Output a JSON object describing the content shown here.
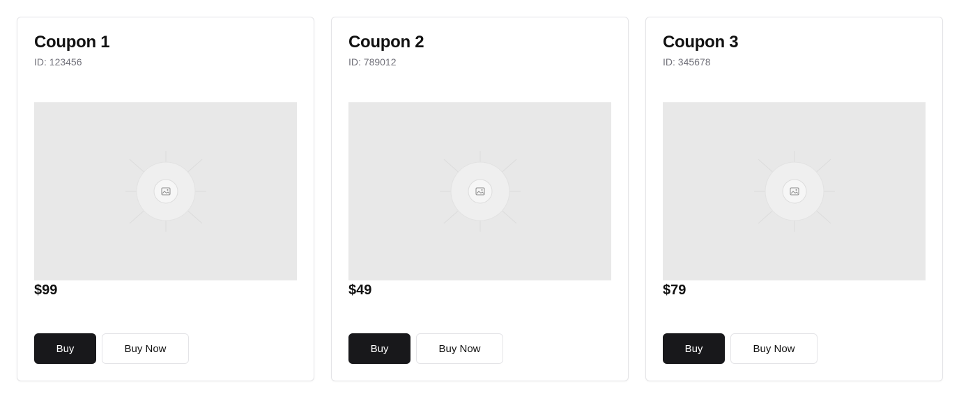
{
  "colors": {
    "primary_button": "#18181b",
    "placeholder_bg": "#e8e8e8",
    "muted_text": "#71717a",
    "border": "#e4e4e7"
  },
  "coupons": [
    {
      "title": "Coupon 1",
      "id_text": "ID: 123456",
      "price": "$99",
      "buy_label": "Buy",
      "buy_now_label": "Buy Now",
      "image_icon": "image-placeholder-icon"
    },
    {
      "title": "Coupon 2",
      "id_text": "ID: 789012",
      "price": "$49",
      "buy_label": "Buy",
      "buy_now_label": "Buy Now",
      "image_icon": "image-placeholder-icon"
    },
    {
      "title": "Coupon 3",
      "id_text": "ID: 345678",
      "price": "$79",
      "buy_label": "Buy",
      "buy_now_label": "Buy Now",
      "image_icon": "image-placeholder-icon"
    }
  ]
}
